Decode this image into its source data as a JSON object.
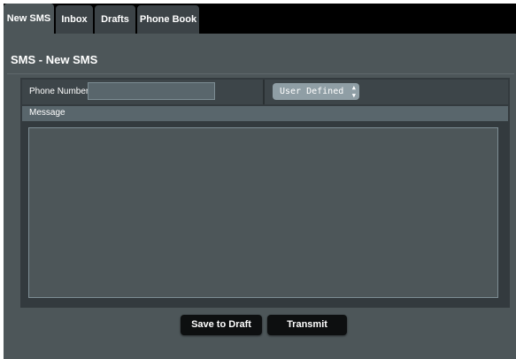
{
  "tabs": [
    {
      "label": "New SMS",
      "active": true
    },
    {
      "label": "Inbox",
      "active": false
    },
    {
      "label": "Drafts",
      "active": false
    },
    {
      "label": "Phone Book",
      "active": false
    }
  ],
  "page": {
    "title": "SMS - New SMS"
  },
  "form": {
    "phone_label": "Phone Number",
    "phone_value": "",
    "number_type_selected": "User Defined",
    "message_label": "Message",
    "message_value": ""
  },
  "buttons": {
    "save_draft": "Save to Draft",
    "transmit": "Transmit"
  },
  "colors": {
    "background": "#000000",
    "panel": "#4d5659",
    "tab_inactive": "#3c4347",
    "button": "#0d0f10",
    "input": "#59666c"
  }
}
